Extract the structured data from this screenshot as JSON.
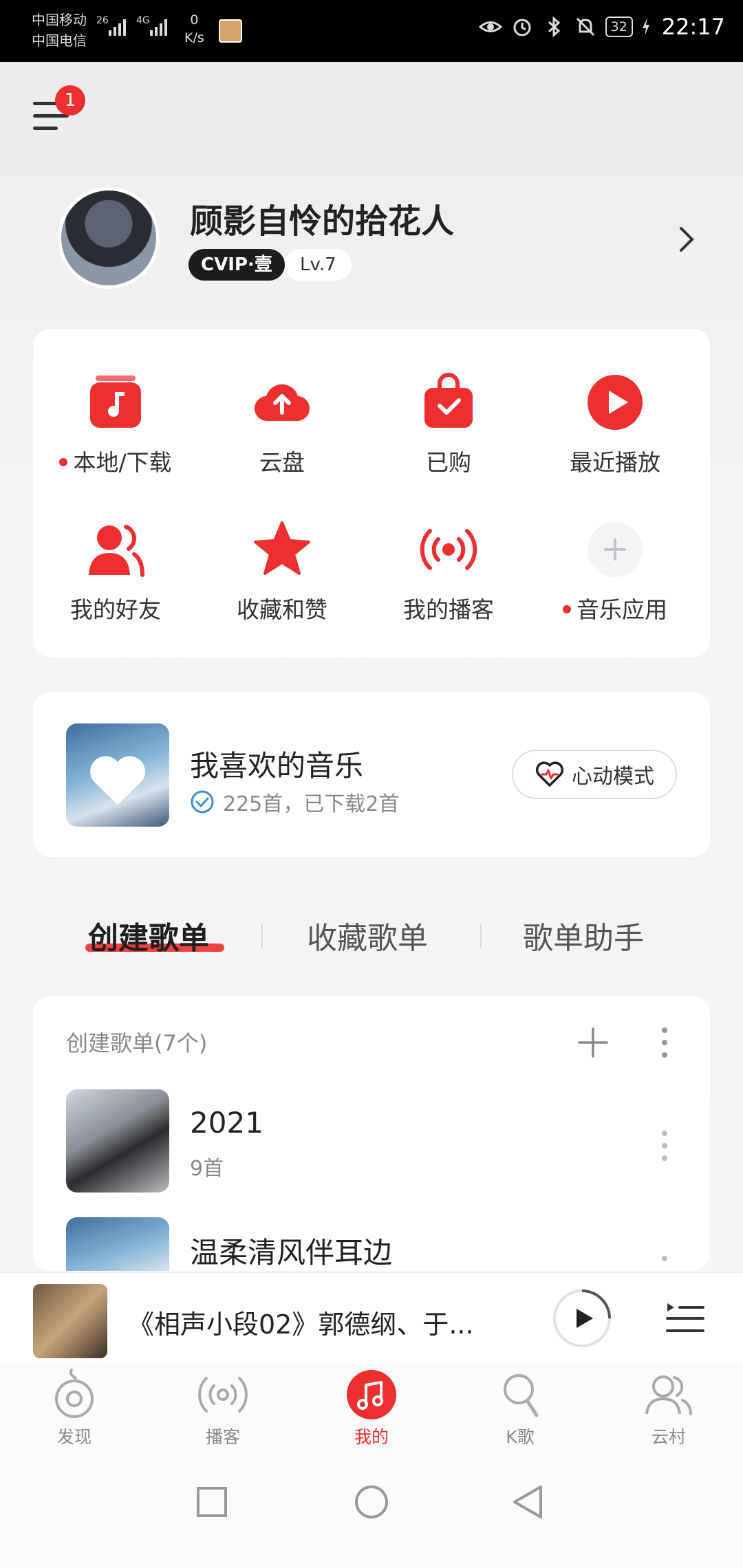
{
  "status_bar": {
    "carrier_1": "中国移动",
    "carrier_2": "中国电信",
    "net_1": "26",
    "net_2": "4G",
    "speed_value": "0",
    "speed_unit": "K/s",
    "battery": "32",
    "time": "22:17"
  },
  "header": {
    "menu_badge": "1"
  },
  "profile": {
    "name": "顾影自怜的拾花人",
    "vip_label": "CVIP·壹",
    "level": "Lv.7"
  },
  "quick_grid": [
    {
      "label": "本地/下载",
      "icon": "music-note-icon",
      "dot": true
    },
    {
      "label": "云盘",
      "icon": "cloud-upload-icon",
      "dot": false
    },
    {
      "label": "已购",
      "icon": "shopping-bag-icon",
      "dot": false
    },
    {
      "label": "最近播放",
      "icon": "play-circle-icon",
      "dot": false
    },
    {
      "label": "我的好友",
      "icon": "friends-icon",
      "dot": false
    },
    {
      "label": "收藏和赞",
      "icon": "star-icon",
      "dot": false
    },
    {
      "label": "我的播客",
      "icon": "podcast-icon",
      "dot": false
    },
    {
      "label": "音乐应用",
      "icon": "plus-icon",
      "dot": true
    }
  ],
  "favorites": {
    "title": "我喜欢的音乐",
    "subtitle": "225首，已下载2首",
    "heart_mode_label": "心动模式"
  },
  "tabs": [
    {
      "label": "创建歌单",
      "active": true
    },
    {
      "label": "收藏歌单",
      "active": false
    },
    {
      "label": "歌单助手",
      "active": false
    }
  ],
  "playlists_section": {
    "header": "创建歌单(7个)",
    "items": [
      {
        "title": "2021",
        "count": "9首"
      },
      {
        "title": "温柔清风伴耳边",
        "count": ""
      }
    ]
  },
  "player": {
    "now_playing": "《相声小段02》郭德纲、于..."
  },
  "bottom_nav": [
    {
      "label": "发现",
      "icon": "discover-icon",
      "active": false
    },
    {
      "label": "播客",
      "icon": "podcast-icon",
      "active": false
    },
    {
      "label": "我的",
      "icon": "music-note-icon",
      "active": true
    },
    {
      "label": "K歌",
      "icon": "microphone-icon",
      "active": false
    },
    {
      "label": "云村",
      "icon": "community-icon",
      "active": false
    }
  ],
  "colors": {
    "accent": "#ee2f2f",
    "background": "#f3f3f5"
  }
}
